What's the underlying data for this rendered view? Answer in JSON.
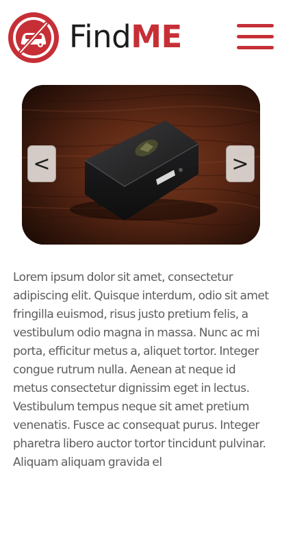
{
  "header": {
    "brand_find": "Find",
    "brand_me": "ME",
    "logo_icon": "no-car-icon",
    "menu_icon": "hamburger-menu-icon"
  },
  "colors": {
    "brand_red": "#c62f36",
    "brand_dark": "#1c1c1c",
    "text_gray": "#5c5c5c",
    "wood_dark": "#3a1a0e"
  },
  "carousel": {
    "prev_label": "<",
    "next_label": ">",
    "slide_image": "gps-tracker-device-on-wood"
  },
  "main": {
    "paragraph": "Lorem ipsum dolor sit amet, consectetur adipiscing elit. Quisque interdum, odio sit amet fringilla euismod, risus justo pretium felis, a vestibulum odio magna in massa. Nunc ac mi porta, efficitur metus a, aliquet tortor. Integer congue rutrum nulla. Aenean at neque id metus consectetur dignissim eget in lectus. Vestibulum tempus neque sit amet pretium venenatis. Fusce ac consequat purus. Integer pharetra libero auctor tortor tincidunt pulvinar. Aliquam aliquam gravida el"
  }
}
